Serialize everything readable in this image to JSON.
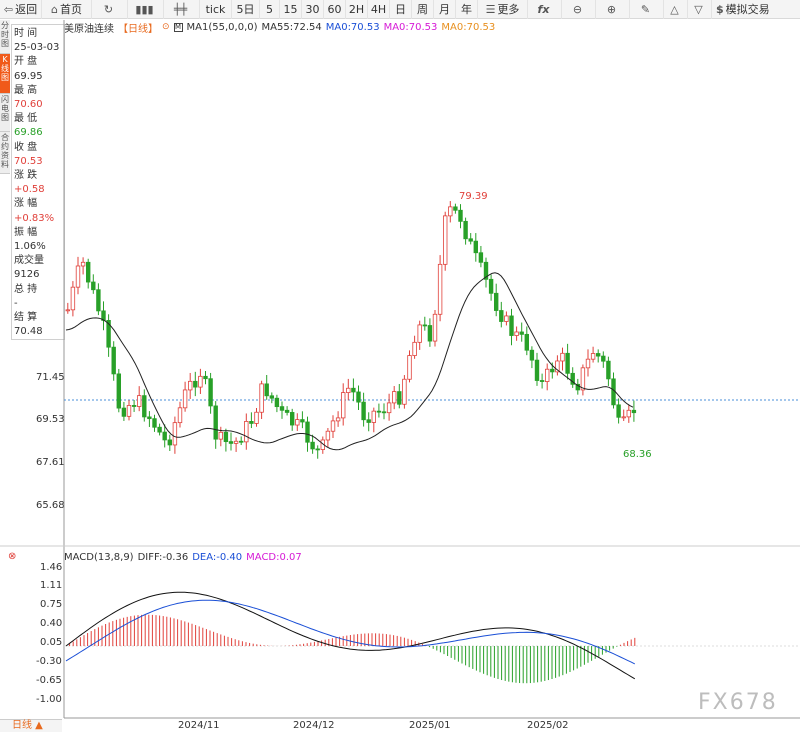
{
  "toolbar": {
    "back": "返回",
    "home": "首页",
    "tick": "tick",
    "d5": "5日",
    "m5": "5",
    "m15": "15",
    "m30": "30",
    "m60": "60",
    "h2": "2H",
    "h4": "4H",
    "day": "日",
    "week": "周",
    "month": "月",
    "year": "年",
    "more": "更多",
    "demo": "模拟交易"
  },
  "legend": {
    "name": "美原油连续",
    "period": "【日线】",
    "ma1": "MA1(55,0,0,0)",
    "ma55": "MA55:72.54",
    "ma70a": "MA0:70.53",
    "ma70b": "MA0:70.53",
    "ma70c": "MA0:70.53"
  },
  "side_tabs": [
    "分时图",
    "K线图",
    "闪电图",
    "合约资料"
  ],
  "info": {
    "time_label": "时 间",
    "time": "25-03-03",
    "open_label": "开 盘",
    "open": "69.95",
    "high_label": "最 高",
    "high": "70.60",
    "low_label": "最 低",
    "low": "69.86",
    "close_label": "收 盘",
    "close": "70.53",
    "change_label": "涨 跌",
    "change": "+0.58",
    "pct_label": "涨 幅",
    "pct": "+0.83%",
    "amp_label": "振 幅",
    "amp": "1.06%",
    "vol_label": "成交量",
    "vol": "9126",
    "oi_label": "总 持",
    "oi": "-",
    "settle_label": "结 算",
    "settle": "70.48"
  },
  "price_axis": [
    "71.45",
    "69.53",
    "67.61",
    "65.68"
  ],
  "annotations": {
    "high": "79.39",
    "low": "68.36"
  },
  "macd": {
    "label": "MACD(13,8,9)",
    "diff": "DIFF:-0.36",
    "dea": "DEA:-0.40",
    "macd": "MACD:0.07",
    "axis": [
      "1.46",
      "1.11",
      "0.75",
      "0.40",
      "0.05",
      "-0.30",
      "-0.65",
      "-1.00"
    ]
  },
  "x_axis": [
    "2024/11",
    "2024/12",
    "2025/01",
    "2025/02"
  ],
  "period_button": "日线 ▲",
  "watermark": "FX678",
  "colors": {
    "up": "#e0403a",
    "down": "#28a028",
    "accent": "#f05a1a",
    "dea": "#1a4fd6",
    "macd": "#d61ad6"
  },
  "chart_data": {
    "type": "candlestick",
    "series": [
      {
        "name": "美原油连续",
        "values": []
      }
    ]
  }
}
